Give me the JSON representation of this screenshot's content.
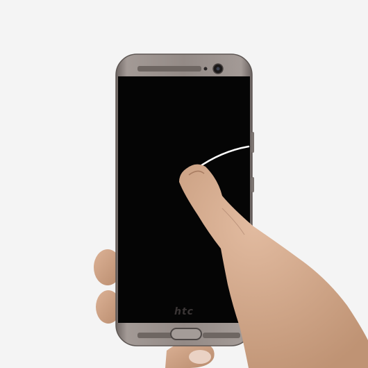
{
  "photo": {
    "background_color": "#f4f4f4",
    "device": {
      "brand": "HTC",
      "body_color": "#8f8784",
      "screen_color": "#050505",
      "screen_state": "off"
    },
    "gesture": "swipe",
    "swipe_trail_color": "#ffffff",
    "skin_color": "#c99e80"
  }
}
